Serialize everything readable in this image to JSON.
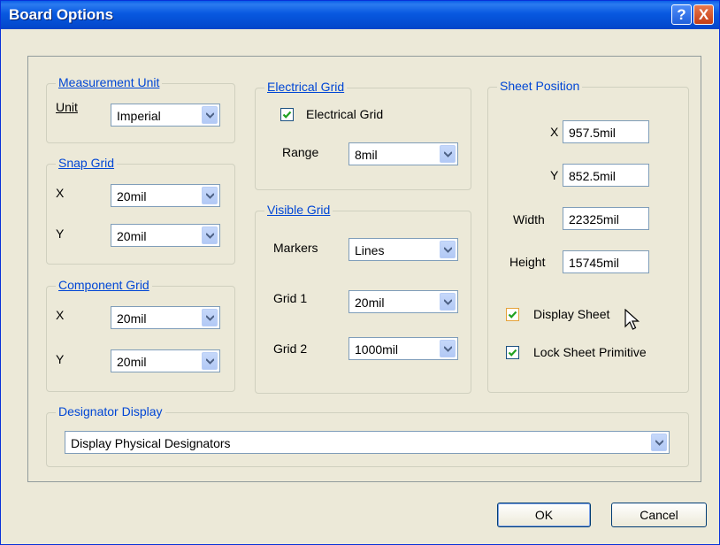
{
  "window": {
    "title": "Board Options",
    "help_glyph": "?",
    "close_glyph": "X"
  },
  "measurement_unit": {
    "legend": "Measurement Unit",
    "unit_label": "Unit",
    "unit_value": "Imperial"
  },
  "snap_grid": {
    "legend": "Snap Grid",
    "x_label": "X",
    "x_value": "20mil",
    "y_label": "Y",
    "y_value": "20mil"
  },
  "component_grid": {
    "legend": "Component Grid",
    "x_label": "X",
    "x_value": "20mil",
    "y_label": "Y",
    "y_value": "20mil"
  },
  "electrical_grid": {
    "legend": "Electrical Grid",
    "checkbox_label": "Electrical Grid",
    "checked": true,
    "range_label": "Range",
    "range_value": "8mil"
  },
  "visible_grid": {
    "legend": "Visible Grid",
    "markers_label": "Markers",
    "markers_value": "Lines",
    "grid1_label": "Grid 1",
    "grid1_value": "20mil",
    "grid2_label": "Grid 2",
    "grid2_value": "1000mil"
  },
  "sheet_position": {
    "legend": "Sheet Position",
    "x_label": "X",
    "x_value": "957.5mil",
    "y_label": "Y",
    "y_value": "852.5mil",
    "width_label": "Width",
    "width_value": "22325mil",
    "height_label": "Height",
    "height_value": "15745mil",
    "display_sheet_label": "Display Sheet",
    "display_sheet_checked": true,
    "lock_primitive_label": "Lock Sheet Primitive",
    "lock_primitive_checked": true
  },
  "designator_display": {
    "legend": "Designator Display",
    "value": "Display Physical Designators"
  },
  "buttons": {
    "ok": "OK",
    "cancel": "Cancel"
  },
  "colors": {
    "title_bar": "#0a5fe8",
    "group_label": "#0046d5",
    "dialog_bg": "#ece9d8"
  },
  "icons": {
    "help": "help-icon",
    "close": "close-icon",
    "dropdown": "chevron-down-icon",
    "check": "check-icon",
    "cursor": "mouse-cursor-icon"
  }
}
